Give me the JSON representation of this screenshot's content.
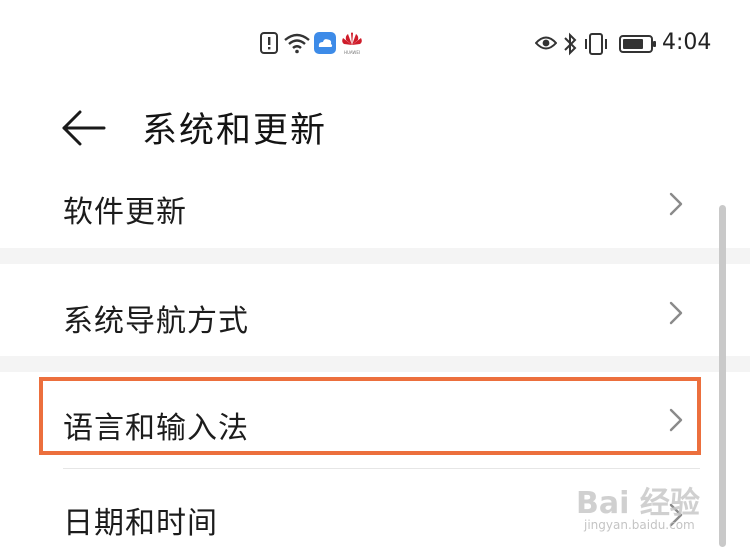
{
  "status_bar": {
    "time": "4:04",
    "icons_left": [
      "alert-icon",
      "wifi-icon",
      "weather-cloud-icon",
      "huawei-logo-icon"
    ],
    "icons_right": [
      "eye-icon",
      "bluetooth-icon",
      "vibrate-icon",
      "battery-icon"
    ],
    "huawei_label": "HUAWEI"
  },
  "header": {
    "title": "系统和更新"
  },
  "settings": {
    "items": [
      {
        "label": "软件更新"
      },
      {
        "label": "系统导航方式"
      },
      {
        "label": "语言和输入法"
      },
      {
        "label": "日期和时间"
      }
    ]
  },
  "highlight": {
    "color": "#ec6f3d",
    "target": "语言和输入法"
  },
  "watermark": {
    "logo": "Bai 经验",
    "url": "jingyan.baidu.com"
  }
}
